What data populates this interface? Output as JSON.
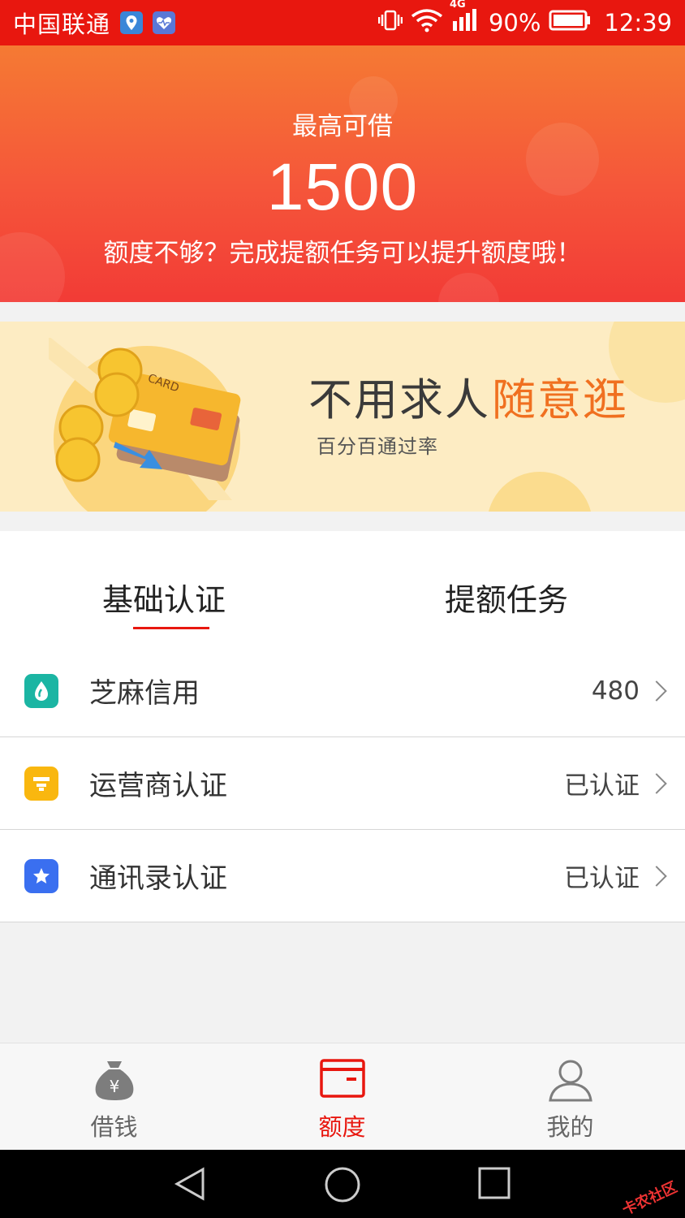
{
  "status_bar": {
    "carrier": "中国联通",
    "battery": "90%",
    "time": "12:39",
    "network": "4G"
  },
  "hero": {
    "title": "最高可借",
    "amount": "1500",
    "hint": "额度不够？完成提额任务可以提升额度哦！"
  },
  "banner": {
    "slogan_main": "不用求人",
    "slogan_accent": "随意逛",
    "subtitle": "百分百通过率",
    "card_text": "CARD"
  },
  "tabs": [
    {
      "label": "基础认证",
      "active": true
    },
    {
      "label": "提额任务",
      "active": false
    }
  ],
  "list": [
    {
      "label": "芝麻信用",
      "value": "480",
      "icon": "sesame-credit-icon",
      "color": "#1bb5a3"
    },
    {
      "label": "运营商认证",
      "value": "已认证",
      "icon": "carrier-auth-icon",
      "color": "#f9b70f"
    },
    {
      "label": "通讯录认证",
      "value": "已认证",
      "icon": "contacts-star-icon",
      "color": "#3a6ff0"
    }
  ],
  "bottom_nav": [
    {
      "label": "借钱",
      "icon": "money-bag-icon",
      "active": false
    },
    {
      "label": "额度",
      "icon": "credit-card-icon",
      "active": true
    },
    {
      "label": "我的",
      "icon": "user-profile-icon",
      "active": false
    }
  ],
  "watermark": "卡农社区",
  "colors": {
    "primary": "#e8170f",
    "hero_top": "#f57a33",
    "hero_bottom": "#f23b36",
    "banner_bg": "#fdecc3",
    "accent_orange": "#f07020"
  }
}
